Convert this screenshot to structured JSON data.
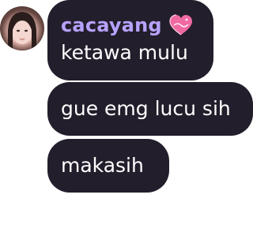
{
  "chat": {
    "author": "cacayang",
    "badge_icon": "heart-lollipop-badge",
    "accent_color": "#b7a2ff",
    "bubble_color": "#231e2b",
    "messages": [
      {
        "text": "ketawa mulu"
      },
      {
        "text": "gue emg lucu sih"
      },
      {
        "text": "makasih"
      }
    ]
  }
}
